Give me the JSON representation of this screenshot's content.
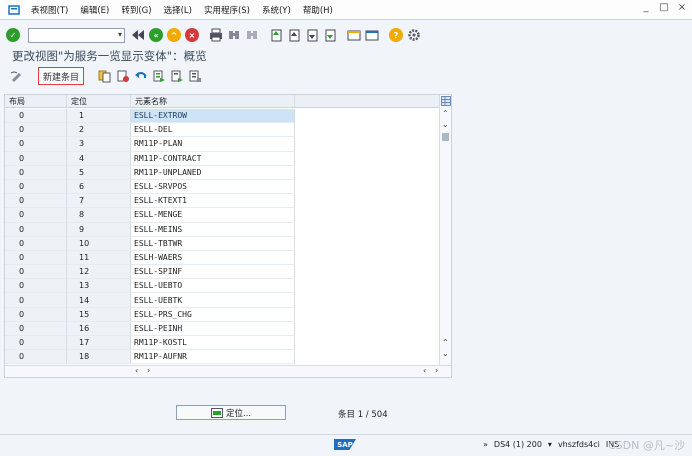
{
  "menu": [
    "表视图(T)",
    "编辑(E)",
    "转到(G)",
    "选择(L)",
    "实用程序(S)",
    "系统(Y)",
    "帮助(H)"
  ],
  "window_controls": [
    "_",
    "□",
    "×"
  ],
  "title": "更改视图\"为服务一览显示变体\"：概览",
  "app_toolbar": {
    "new_entry_label": "新建条目"
  },
  "table": {
    "headers": [
      "布局",
      "定位",
      "元素名称"
    ],
    "rows": [
      [
        "0",
        "1",
        "ESLL-EXTROW"
      ],
      [
        "0",
        "2",
        "ESLL-DEL"
      ],
      [
        "0",
        "3",
        "RM11P-PLAN"
      ],
      [
        "0",
        "4",
        "RM11P-CONTRACT"
      ],
      [
        "0",
        "5",
        "RM11P-UNPLANED"
      ],
      [
        "0",
        "6",
        "ESLL-SRVPOS"
      ],
      [
        "0",
        "7",
        "ESLL-KTEXT1"
      ],
      [
        "0",
        "8",
        "ESLL-MENGE"
      ],
      [
        "0",
        "9",
        "ESLL-MEINS"
      ],
      [
        "0",
        "10",
        "ESLL-TBTWR"
      ],
      [
        "0",
        "11",
        "ESLH-WAERS"
      ],
      [
        "0",
        "12",
        "ESLL-SPINF"
      ],
      [
        "0",
        "13",
        "ESLL-UEBTO"
      ],
      [
        "0",
        "14",
        "ESLL-UEBTK"
      ],
      [
        "0",
        "15",
        "ESLL-PRS_CHG"
      ],
      [
        "0",
        "16",
        "ESLL-PEINH"
      ],
      [
        "0",
        "17",
        "RM11P-KOSTL"
      ],
      [
        "0",
        "18",
        "RM11P-AUFNR"
      ]
    ]
  },
  "position_button_label": "定位...",
  "entry_count": "条目 1 / 504",
  "status": {
    "sap_logo_text": "SAP",
    "arrows": "»",
    "system": "DS4 (1) 200",
    "host": "vhszfds4ci",
    "mode": "INS"
  },
  "watermark": "CSDN @凡~沙",
  "colors": {
    "accent_green": "#2e9d2e",
    "red": "#d43a3a",
    "yellow": "#f2a900",
    "highlight_border": "#e53e3e"
  }
}
